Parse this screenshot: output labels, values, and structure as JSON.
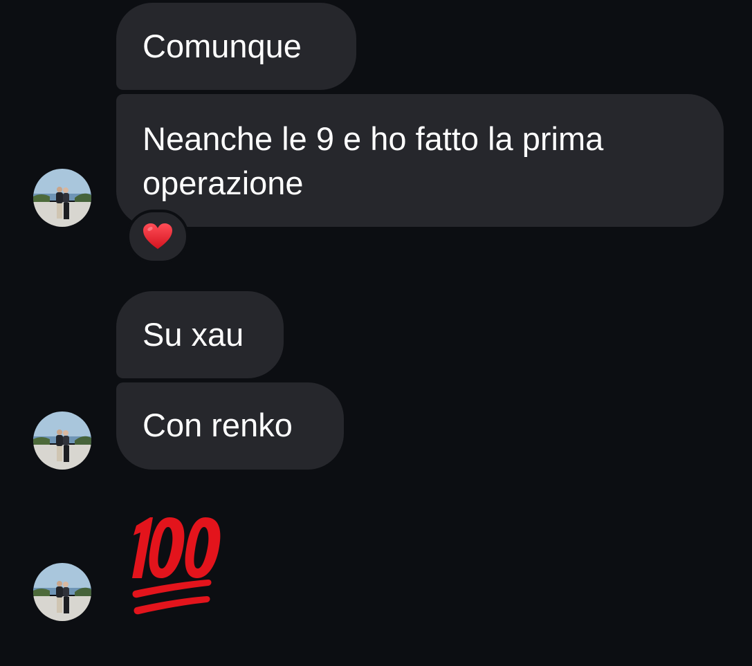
{
  "messages": [
    {
      "text": "Comunque"
    },
    {
      "text": "Neanche le 9 e ho fatto la prima operazione"
    },
    {
      "text": "Su xau"
    },
    {
      "text": "Con renko"
    }
  ],
  "reaction": {
    "icon": "red-heart-icon",
    "color": "#e8202c"
  },
  "big_emoji": {
    "icon": "hundred-points-icon",
    "color": "#e3141c"
  },
  "colors": {
    "background": "#0c0e12",
    "bubble": "#26272c",
    "text": "#ffffff"
  }
}
